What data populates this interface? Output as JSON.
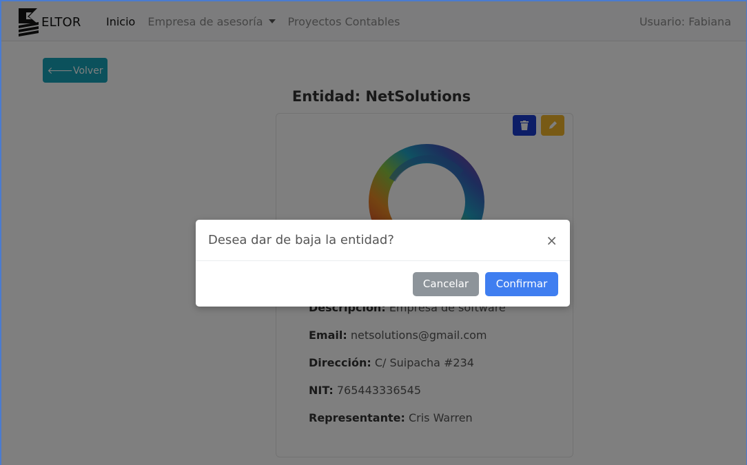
{
  "navbar": {
    "brand": "ELTOR",
    "links": [
      {
        "label": "Inicio"
      },
      {
        "label": "Empresa de asesoría"
      },
      {
        "label": "Proyectos Contables"
      }
    ],
    "user": "Usuario: Fabiana"
  },
  "page": {
    "back_label": "🡐Volver",
    "title": "Entidad: NetSolutions"
  },
  "card": {
    "actions": {
      "delete_icon": "trash-icon",
      "edit_icon": "pencil-icon"
    },
    "image_icon": "ring-logo",
    "fields": [
      {
        "label": "Descripción:",
        "value": "Empresa de software"
      },
      {
        "label": "Email:",
        "value": "netsolutions@gmail.com"
      },
      {
        "label": "Dirección:",
        "value": "C/ Suipacha #234"
      },
      {
        "label": "NIT:",
        "value": "765443336545"
      },
      {
        "label": "Representante:",
        "value": "Cris Warren"
      }
    ]
  },
  "modal": {
    "title": "Desea dar de baja la entidad?",
    "close": "×",
    "cancel_label": "Cancelar",
    "confirm_label": "Confirmar"
  },
  "colors": {
    "back_button": "#17a2b8",
    "delete_button": "#1b3ccf",
    "edit_button": "#f0b42a",
    "cancel_button": "#8d949a",
    "confirm_button": "#3f7ef0"
  }
}
